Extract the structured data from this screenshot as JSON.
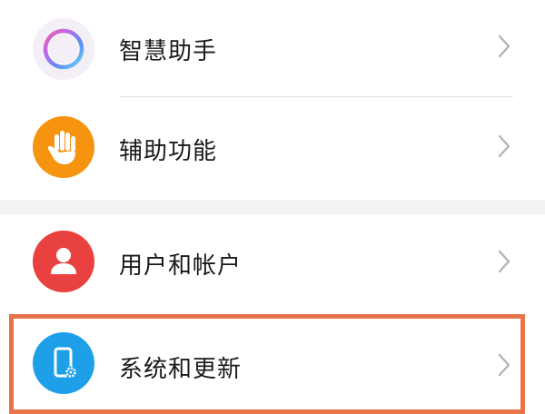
{
  "settings": {
    "items": [
      {
        "label": "智慧助手",
        "icon": "assistant-ring-icon"
      },
      {
        "label": "辅助功能",
        "icon": "hand-icon",
        "color": "#f6930f"
      },
      {
        "label": "用户和帐户",
        "icon": "user-icon",
        "color": "#e94040"
      },
      {
        "label": "系统和更新",
        "icon": "phone-settings-icon",
        "color": "#1ea0e8"
      }
    ]
  },
  "highlight": {
    "color": "#e8744a",
    "target": "系统和更新"
  }
}
